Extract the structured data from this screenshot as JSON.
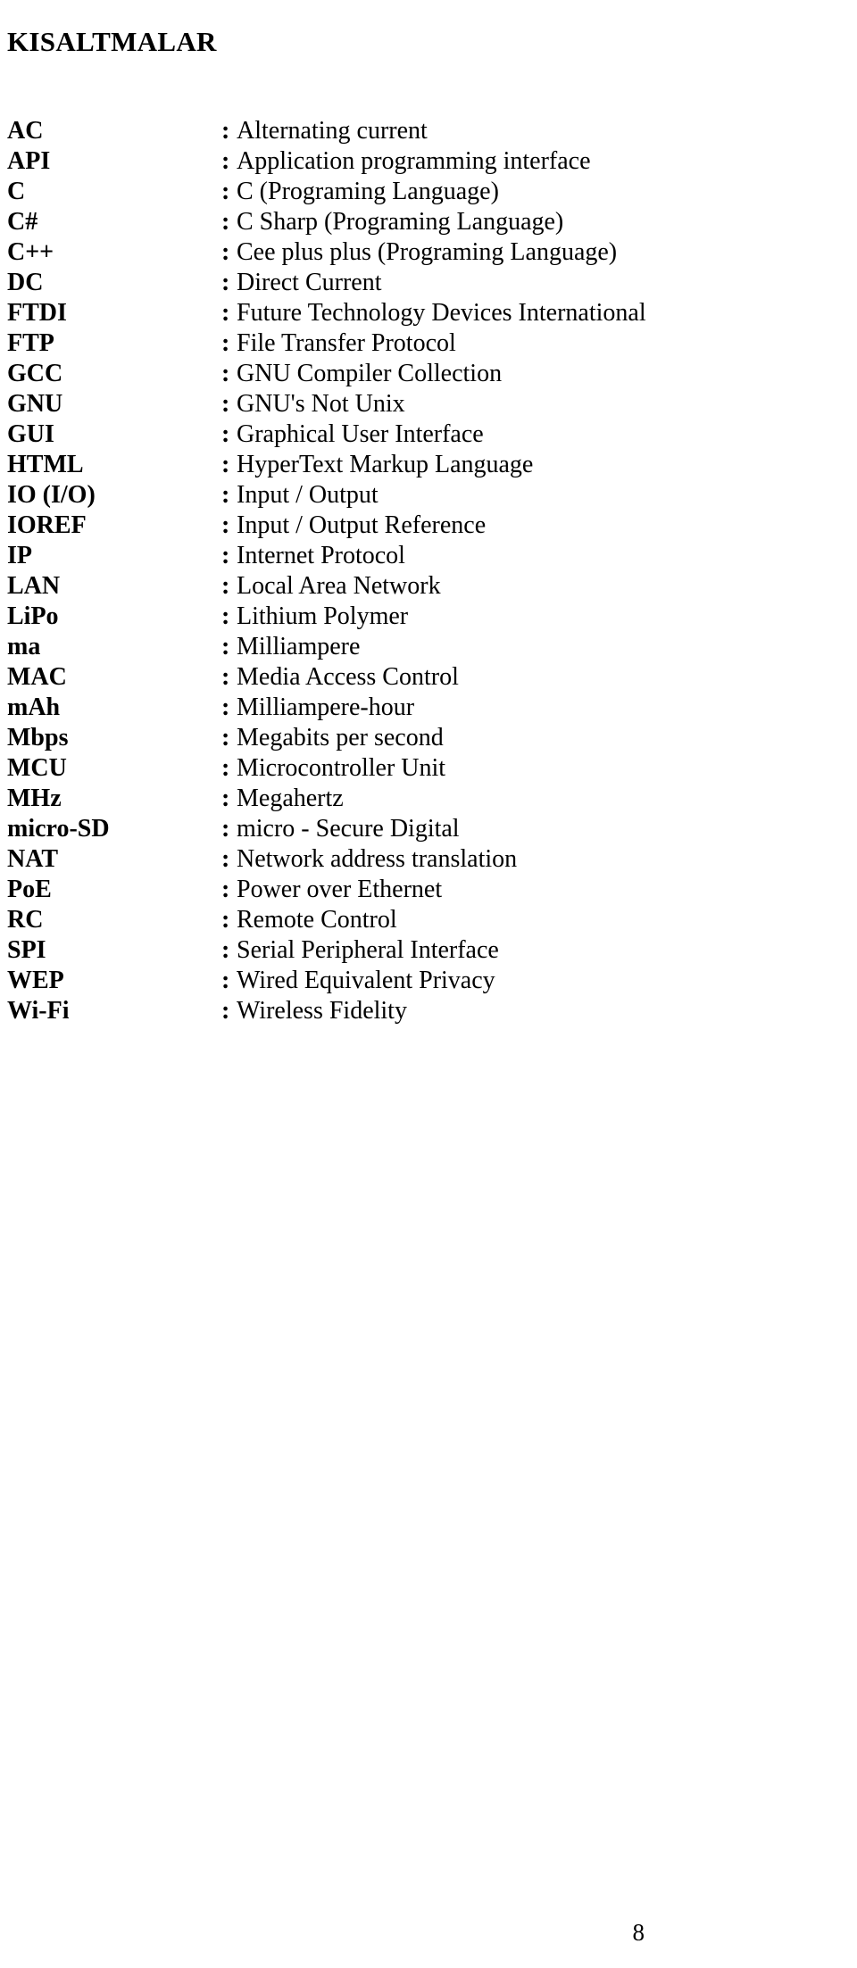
{
  "document": {
    "title": "KISALTMALAR",
    "separator": ":",
    "page_number": "8",
    "text_color": "#000000",
    "background_color": "#ffffff"
  },
  "abbreviations": [
    {
      "term": "AC",
      "definition": "Alternating current"
    },
    {
      "term": "API",
      "definition": "Application programming interface"
    },
    {
      "term": "C",
      "definition": "C (Programing Language)"
    },
    {
      "term": "C#",
      "definition": "C Sharp (Programing Language)"
    },
    {
      "term": "C++",
      "definition": "Cee plus plus (Programing Language)"
    },
    {
      "term": "DC",
      "definition": "Direct Current"
    },
    {
      "term": "FTDI",
      "definition": "Future Technology Devices International"
    },
    {
      "term": "FTP",
      "definition": "File Transfer Protocol"
    },
    {
      "term": "GCC",
      "definition": "GNU Compiler Collection"
    },
    {
      "term": "GNU",
      "definition": "GNU's Not Unix"
    },
    {
      "term": "GUI",
      "definition": "Graphical User Interface"
    },
    {
      "term": "HTML",
      "definition": "HyperText Markup Language"
    },
    {
      "term": "IO (I/O)",
      "definition": "Input / Output"
    },
    {
      "term": "IOREF",
      "definition": "Input / Output Reference"
    },
    {
      "term": "IP",
      "definition": "Internet Protocol"
    },
    {
      "term": "LAN",
      "definition": "Local Area Network"
    },
    {
      "term": "LiPo",
      "definition": "Lithium Polymer"
    },
    {
      "term": "ma",
      "definition": "Milliampere"
    },
    {
      "term": "MAC",
      "definition": "Media Access Control"
    },
    {
      "term": "mAh",
      "definition": "Milliampere-hour"
    },
    {
      "term": "Mbps",
      "definition": "Megabits per second"
    },
    {
      "term": "MCU",
      "definition": "Microcontroller Unit"
    },
    {
      "term": "MHz",
      "definition": "Megahertz"
    },
    {
      "term": "micro-SD",
      "definition": "micro - Secure Digital"
    },
    {
      "term": "NAT",
      "definition": "Network address translation"
    },
    {
      "term": "PoE",
      "definition": "Power over Ethernet"
    },
    {
      "term": "RC",
      "definition": "Remote Control"
    },
    {
      "term": "SPI",
      "definition": "Serial Peripheral Interface"
    },
    {
      "term": "WEP",
      "definition": "Wired Equivalent Privacy"
    },
    {
      "term": "Wi-Fi",
      "definition": "Wireless Fidelity"
    }
  ]
}
